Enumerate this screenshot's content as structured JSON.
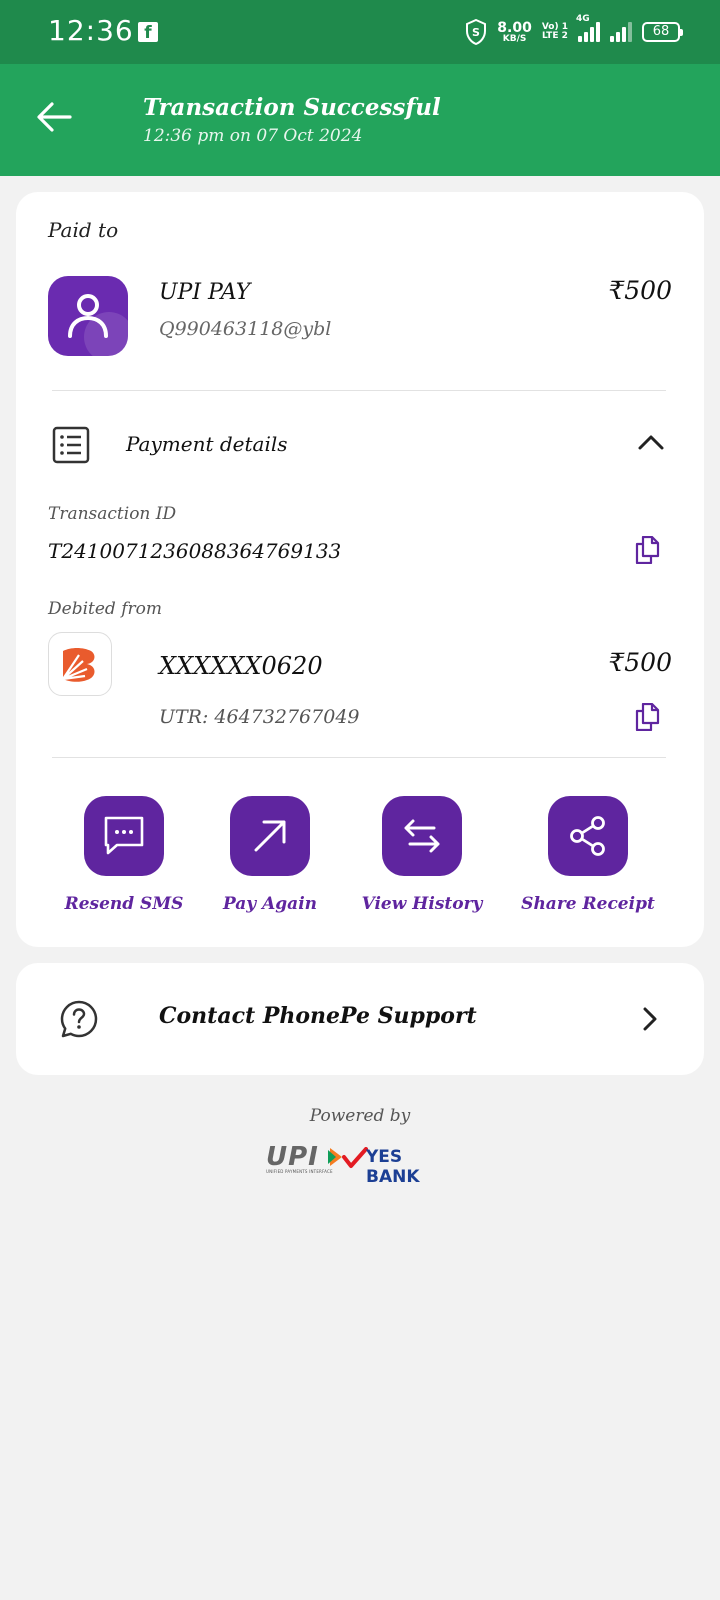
{
  "status_bar": {
    "time": "12:36",
    "app_icon": "facebook-icon",
    "speed_value": "8.00",
    "speed_unit": "KB/S",
    "volte_top": "Vo) 1",
    "volte_bottom": "LTE 2",
    "network": "4G",
    "battery": "68"
  },
  "header": {
    "title": "Transaction Successful",
    "subtitle": "12:36 pm on 07 Oct 2024",
    "color": "#23a45c"
  },
  "paid_to": {
    "label": "Paid to",
    "name": "UPI PAY",
    "upi_id": "Q990463118@ybl",
    "amount": "₹500"
  },
  "payment_details": {
    "title": "Payment details",
    "transaction_id_label": "Transaction ID",
    "transaction_id": "T2410071236088364769133",
    "debited_label": "Debited from",
    "account": "XXXXXX0620",
    "amount": "₹500",
    "utr": "UTR: 464732767049"
  },
  "actions": [
    {
      "label": "Resend SMS",
      "icon": "message-icon"
    },
    {
      "label": "Pay Again",
      "icon": "arrow-up-right-icon"
    },
    {
      "label": "View History",
      "icon": "swap-arrows-icon"
    },
    {
      "label": "Share Receipt",
      "icon": "share-icon"
    }
  ],
  "support": {
    "label": "Contact PhonePe Support"
  },
  "footer": {
    "powered_by": "Powered by",
    "upi_logo": "UPI",
    "upi_tagline": "UNIFIED PAYMENTS INTERFACE",
    "bank_logo": "YES BANK"
  },
  "colors": {
    "status_bar": "#1f8a4c",
    "brand_purple": "#5f259f",
    "background": "#f2f2f2"
  }
}
